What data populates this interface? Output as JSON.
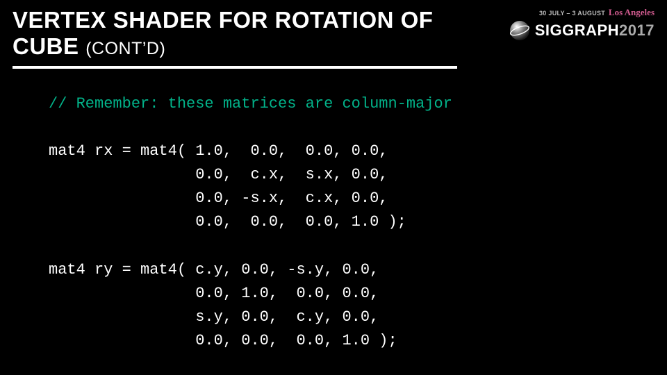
{
  "header": {
    "line1": "VERTEX SHADER FOR ROTATION OF",
    "line2_main": "CUBE ",
    "line2_sub": "(CONT’D)"
  },
  "brand": {
    "dates": "30 JULY – 3 AUGUST",
    "city": "Los Angeles",
    "name": "SIGGRAPH",
    "year": "2017"
  },
  "code": {
    "comment": "// Remember: these matrices are column-major",
    "rx_l1": "mat4 rx = mat4( 1.0,  0.0,  0.0, 0.0,",
    "rx_l2": "                0.0,  c.x,  s.x, 0.0,",
    "rx_l3": "                0.0, -s.x,  c.x, 0.0,",
    "rx_l4": "                0.0,  0.0,  0.0, 1.0 );",
    "ry_l1": "mat4 ry = mat4( c.y, 0.0, -s.y, 0.0,",
    "ry_l2": "                0.0, 1.0,  0.0, 0.0,",
    "ry_l3": "                s.y, 0.0,  c.y, 0.0,",
    "ry_l4": "                0.0, 0.0,  0.0, 1.0 );"
  }
}
